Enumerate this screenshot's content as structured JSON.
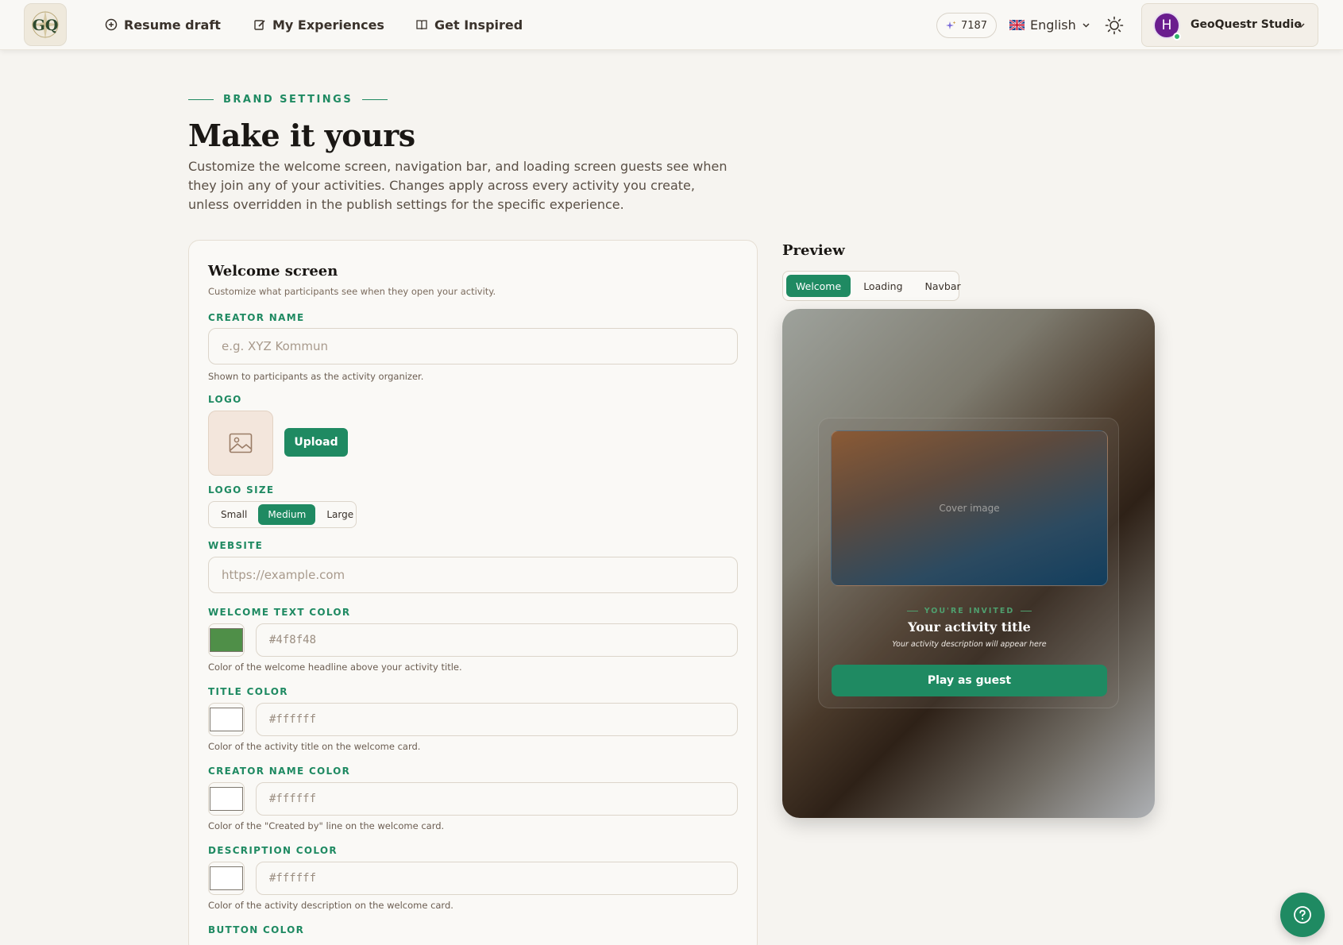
{
  "navbar": {
    "logo_text": "GQ",
    "links": [
      {
        "label": "Resume draft",
        "icon": "plus-circle-icon"
      },
      {
        "label": "My Experiences",
        "icon": "edit-icon"
      },
      {
        "label": "Get Inspired",
        "icon": "book-open-icon"
      }
    ],
    "credits": "7187",
    "credits_icon": "sparkle-icon",
    "language": "English",
    "theme_icon": "sun-icon",
    "profile": {
      "initial": "H",
      "name": "GeoQuestr Studio",
      "status": "online"
    }
  },
  "header": {
    "eyebrow": "BRAND SETTINGS",
    "title": "Make it yours",
    "description": "Customize the welcome screen, navigation bar, and loading screen guests see when they join any of your activities. Changes apply across every activity you create, unless overridden in the publish settings for the specific experience."
  },
  "form": {
    "title": "Welcome screen",
    "subtitle": "Customize what participants see when they open your activity.",
    "creator_name": {
      "label": "CREATOR NAME",
      "placeholder": "e.g. XYZ Kommun",
      "help": "Shown to participants as the activity organizer."
    },
    "logo": {
      "label": "LOGO",
      "upload_label": "Upload"
    },
    "logo_size": {
      "label": "LOGO SIZE",
      "options": [
        "Small",
        "Medium",
        "Large"
      ],
      "selected": "Medium"
    },
    "website": {
      "label": "WEBSITE",
      "placeholder": "https://example.com"
    },
    "welcome_text_color": {
      "label": "WELCOME TEXT COLOR",
      "value": "#4f8f48",
      "placeholder": "#4f8f48",
      "help": "Color of the welcome headline above your activity title."
    },
    "title_color": {
      "label": "TITLE COLOR",
      "value": "#ffffff",
      "placeholder": "#ffffff",
      "help": "Color of the activity title on the welcome card."
    },
    "creator_name_color": {
      "label": "CREATOR NAME COLOR",
      "value": "#ffffff",
      "placeholder": "#ffffff",
      "help": "Color of the \"Created by\" line on the welcome card."
    },
    "description_color": {
      "label": "DESCRIPTION COLOR",
      "value": "#ffffff",
      "placeholder": "#ffffff",
      "help": "Color of the activity description on the welcome card."
    },
    "button_color": {
      "label": "BUTTON COLOR"
    }
  },
  "preview": {
    "title": "Preview",
    "tabs": [
      "Welcome",
      "Loading",
      "Navbar"
    ],
    "active_tab": "Welcome",
    "cover_label": "Cover image",
    "invited": "YOU'RE INVITED",
    "activity_title": "Your activity title",
    "activity_desc": "Your activity description will appear here",
    "guest_button": "Play as guest"
  },
  "colors": {
    "accent": "#1f8a62",
    "background": "#f6f4f0"
  },
  "help_icon": "help-circle-icon"
}
